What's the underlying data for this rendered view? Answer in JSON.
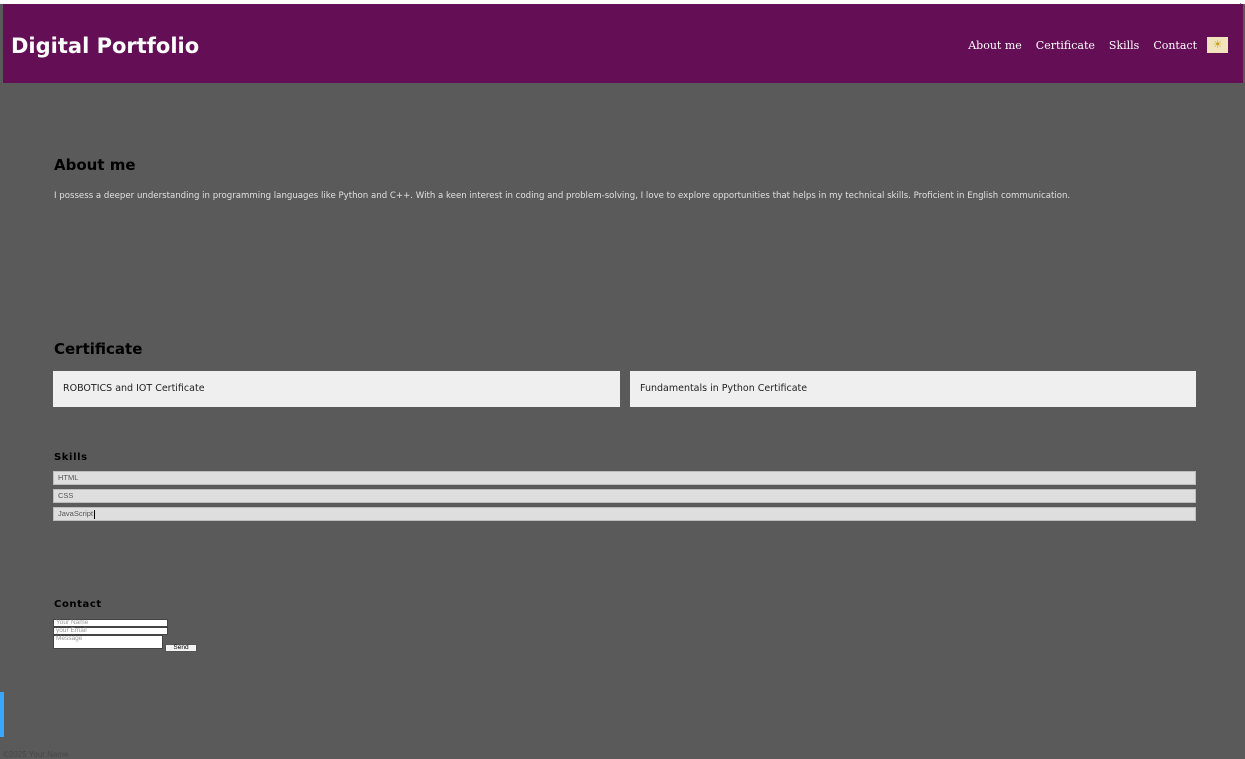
{
  "header": {
    "brand": "Digital Portfolio",
    "nav": [
      "About me",
      "Certificate",
      "Skills",
      "Contact"
    ],
    "theme_toggle_icon": "sun-icon"
  },
  "about": {
    "heading": "About me",
    "text": "I possess a deeper understanding in programming languages like Python and C++. With a keen interest in coding and problem-solving, I love to explore opportunities that helps in my technical skills. Proficient in English communication."
  },
  "certificate": {
    "heading": "Certificate",
    "items": [
      "ROBOTICS and IOT Certificate",
      "Fundamentals in Python Certificate"
    ]
  },
  "skills": {
    "heading": "Skills",
    "items": [
      "HTML",
      "CSS",
      "JavaScript"
    ]
  },
  "contact": {
    "heading": "Contact",
    "name_placeholder": "Your Name",
    "email_placeholder": "your Email",
    "message_placeholder": "Message",
    "send_label": "Send"
  },
  "footer": {
    "text": "©2025 Your Name"
  },
  "colors": {
    "navbar": "#640f55",
    "background": "#5a5a5a",
    "card": "#efefef"
  }
}
